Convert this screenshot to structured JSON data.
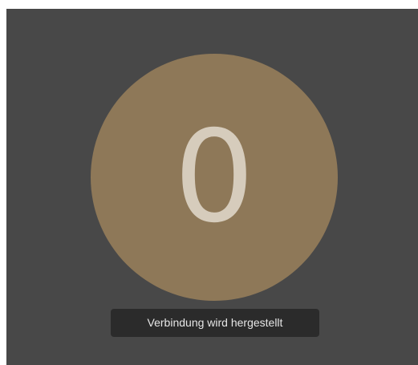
{
  "call": {
    "avatar_initial": "0",
    "avatar_color": "#8e7858",
    "background_color": "#484848",
    "status_text": "Verbindung wird hergestellt"
  }
}
